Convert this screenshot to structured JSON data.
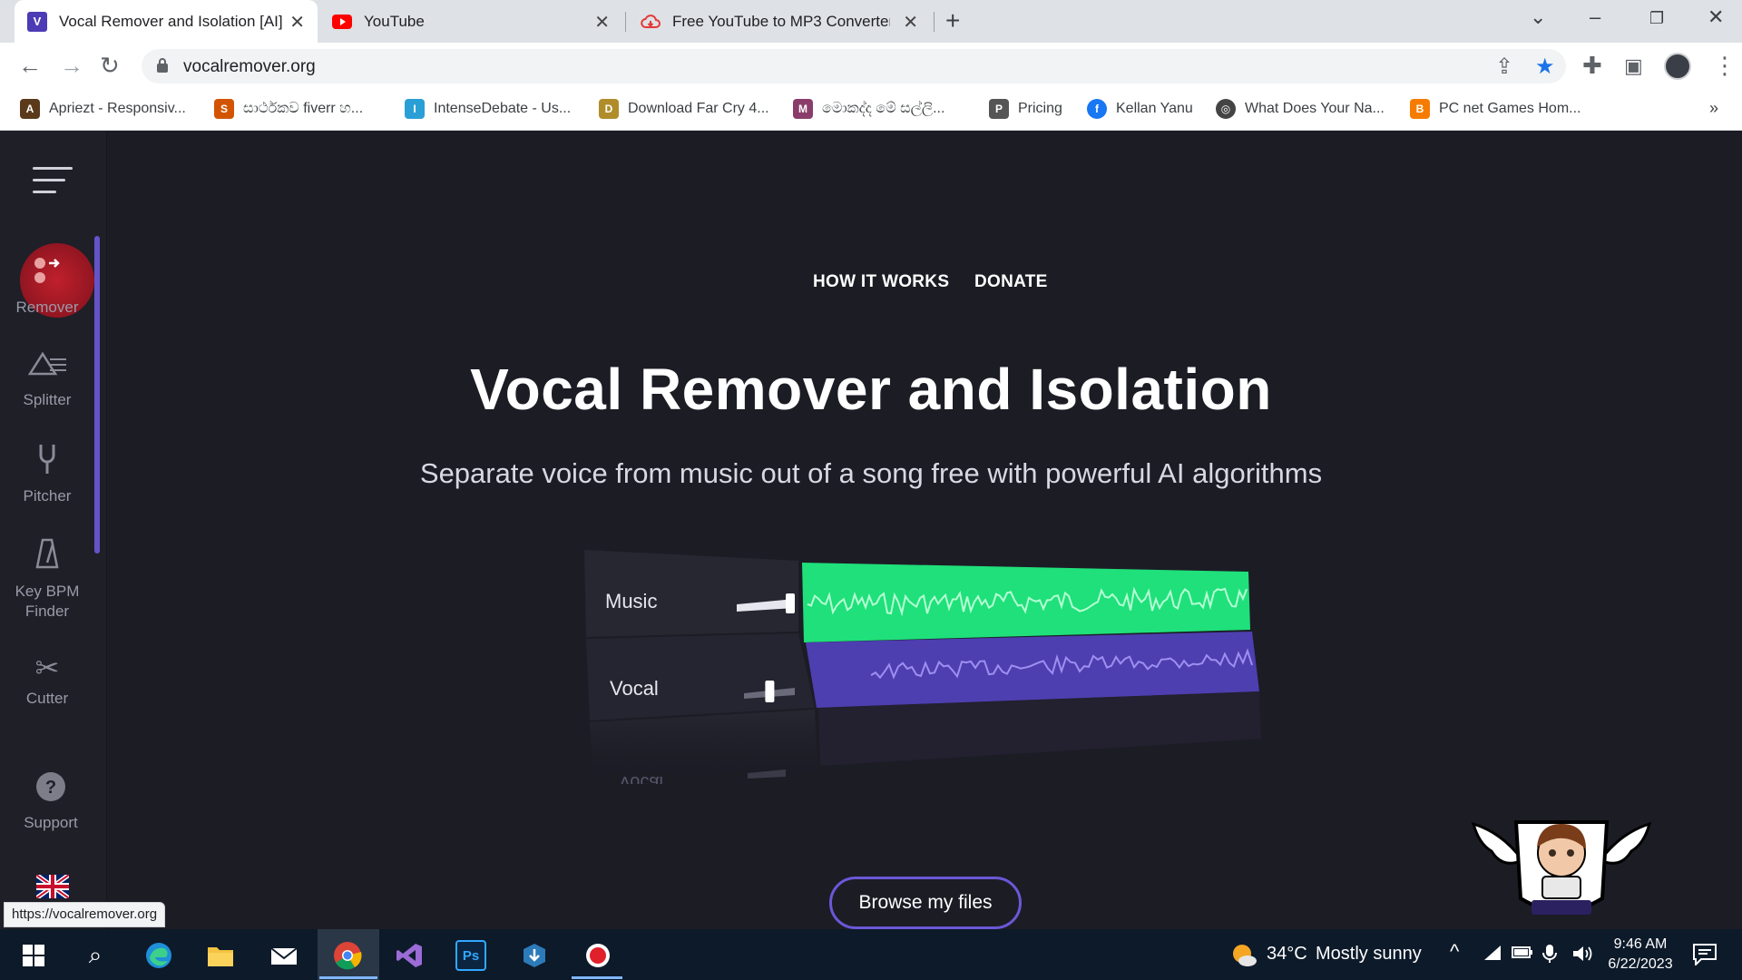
{
  "browser": {
    "tabs": [
      {
        "title": "Vocal Remover and Isolation [AI]",
        "favicon": "V",
        "favicon_color": "#4b3bb5",
        "active": true
      },
      {
        "title": "YouTube",
        "favicon": "youtube-icon",
        "favicon_color": "#ff0000",
        "active": false
      },
      {
        "title": "Free YouTube to MP3 Converter -",
        "favicon": "cloud-download-icon",
        "favicon_color": "#e53935",
        "active": false
      }
    ],
    "url": "vocalremover.org",
    "bookmarks": [
      {
        "label": "Apriezt - Responsiv...",
        "icon_color": "#5a3a1a"
      },
      {
        "label": "සාර්ථකව fiverr හ...",
        "icon_color": "#d35400"
      },
      {
        "label": "IntenseDebate - Us...",
        "icon_color": "#2a9fd6"
      },
      {
        "label": "Download Far Cry 4...",
        "icon_color": "#b08d2a"
      },
      {
        "label": "මොකද්ද මේ සල්ලි...",
        "icon_color": "#8a3d6b"
      },
      {
        "label": "Pricing",
        "icon_color": "#555555"
      },
      {
        "label": "Kellan Yanu",
        "icon_color": "#1877f2"
      },
      {
        "label": "What Does Your Na...",
        "icon_color": "#444444"
      },
      {
        "label": "PC net Games Hom...",
        "icon_color": "#f57c00"
      }
    ],
    "status_url": "https://vocalremover.org"
  },
  "sidebar": {
    "items": [
      {
        "label": "Remover",
        "icon": "remover-icon",
        "active": true
      },
      {
        "label": "Splitter",
        "icon": "splitter-icon"
      },
      {
        "label": "Pitcher",
        "icon": "tuning-fork-icon"
      },
      {
        "label": "Key BPM Finder",
        "icon": "metronome-icon"
      },
      {
        "label": "Cutter",
        "icon": "scissors-icon"
      },
      {
        "label": "Support",
        "icon": "help-icon"
      }
    ],
    "language_flag": "uk-flag"
  },
  "header": {
    "nav": [
      "HOW IT WORKS",
      "DONATE"
    ]
  },
  "hero": {
    "title": "Vocal Remover and Isolation",
    "subtitle": "Separate voice from music out of a song free with powerful AI algorithms"
  },
  "mixer": {
    "tracks": [
      {
        "label": "Music",
        "color": "#1fe07a",
        "volume": 0.9
      },
      {
        "label": "Vocal",
        "color": "#5b49c9",
        "volume": 0.45
      }
    ],
    "reflection_label": "Vocal"
  },
  "cta": {
    "browse_label": "Browse my files"
  },
  "taskbar": {
    "weather_temp": "34°C",
    "weather_text": "Mostly sunny",
    "time": "9:46 AM",
    "date": "6/22/2023"
  },
  "colors": {
    "page_bg": "#1c1c25",
    "accent": "#6a58d8",
    "active_red": "#c0202c"
  }
}
